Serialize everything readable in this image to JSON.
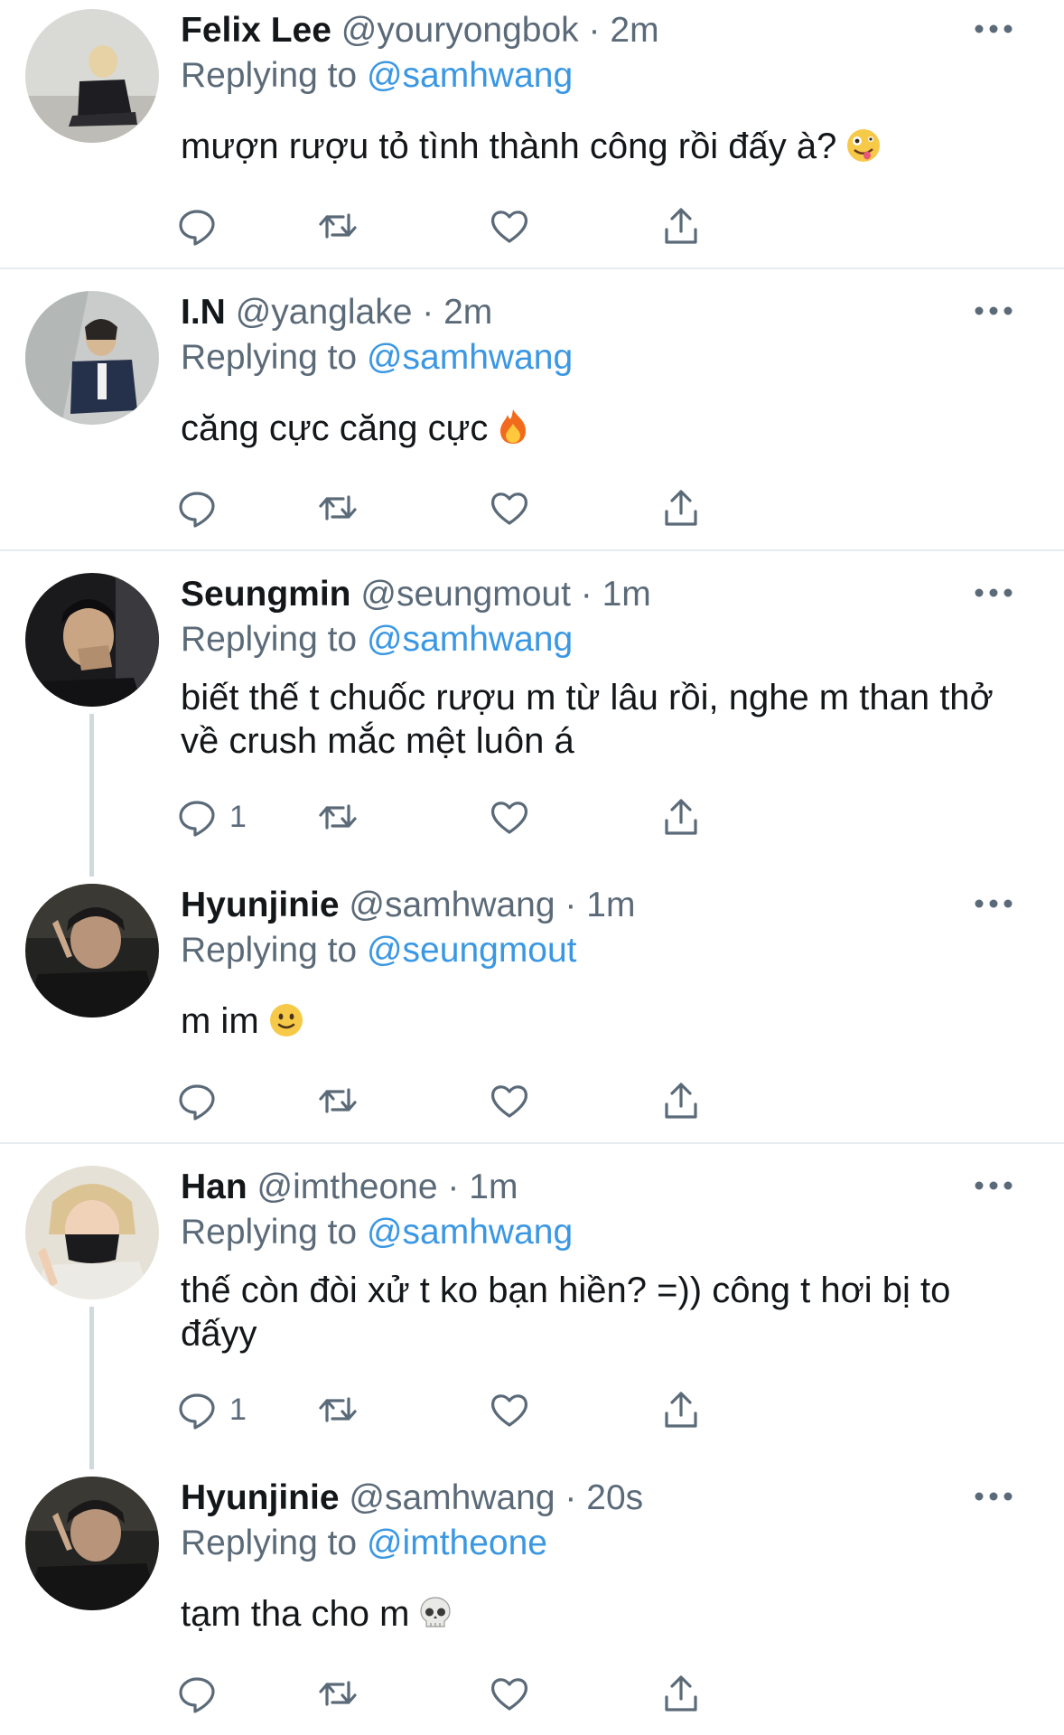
{
  "colors": {
    "accent": "#3a97e3",
    "secondary_text": "#5b6a78",
    "primary_text": "#14171a",
    "divider": "#e6ecf0",
    "thread_line": "#cfd9de"
  },
  "tweets": [
    {
      "name": "Felix Lee",
      "handle": "@youryongbok",
      "sep": "·",
      "time": "2m",
      "replying_label": "Replying to",
      "replying_to": "@samhwang",
      "text": "mượn rượu tỏ tình thành công rồi đấy à?",
      "emoji": "zany-face-icon",
      "reply_count": "",
      "menu_icon": "more-horizontal-icon"
    },
    {
      "name": "I.N",
      "handle": "@yanglake",
      "sep": "·",
      "time": "2m",
      "replying_label": "Replying to",
      "replying_to": "@samhwang",
      "text": "căng cực căng cực",
      "emoji": "fire-icon",
      "reply_count": "",
      "menu_icon": "more-horizontal-icon"
    },
    {
      "name": "Seungmin",
      "handle": "@seungmout",
      "sep": "·",
      "time": "1m",
      "replying_label": "Replying to",
      "replying_to": "@samhwang",
      "text": "biết thế t chuốc rượu m từ lâu rồi, nghe m than thở về crush mắc mệt luôn á",
      "emoji": "",
      "reply_count": "1",
      "menu_icon": "more-horizontal-icon"
    },
    {
      "name": "Hyunjinie",
      "handle": "@samhwang",
      "sep": "·",
      "time": "1m",
      "replying_label": "Replying to",
      "replying_to": "@seungmout",
      "text": "m im",
      "emoji": "slightly-smiling-face-icon",
      "reply_count": "",
      "menu_icon": "more-horizontal-icon"
    },
    {
      "name": "Han",
      "handle": "@imtheone",
      "sep": "·",
      "time": "1m",
      "replying_label": "Replying to",
      "replying_to": "@samhwang",
      "text": "thế còn đòi xử t ko bạn hiền? =)) công t hơi bị to đấyy",
      "emoji": "",
      "reply_count": "1",
      "menu_icon": "more-horizontal-icon"
    },
    {
      "name": "Hyunjinie",
      "handle": "@samhwang",
      "sep": "·",
      "time": "20s",
      "replying_label": "Replying to",
      "replying_to": "@imtheone",
      "text": "tạm tha cho m",
      "emoji": "skull-icon",
      "reply_count": "",
      "menu_icon": "more-horizontal-icon"
    }
  ],
  "action_icons": [
    "reply-icon",
    "retweet-icon",
    "like-icon",
    "share-icon"
  ]
}
